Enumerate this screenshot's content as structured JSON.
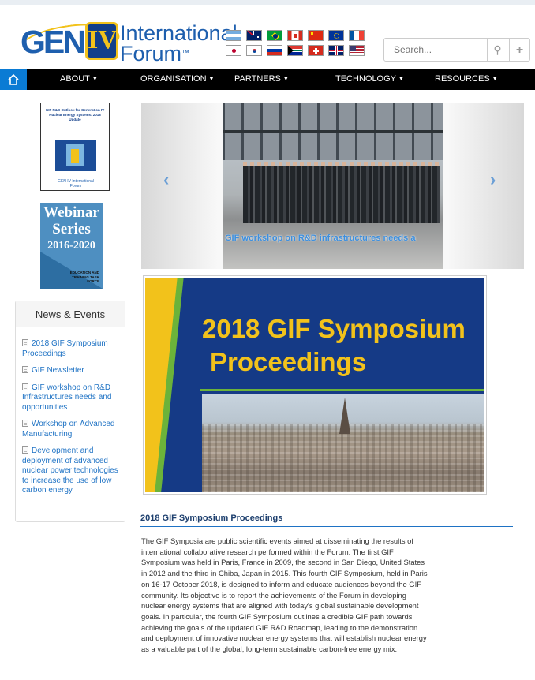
{
  "header": {
    "logo": {
      "gen": "GEN",
      "iv": "IV",
      "line1": "International",
      "line2": "Forum",
      "tm": "™"
    },
    "flags": [
      "argentina-flag",
      "australia-flag",
      "brazil-flag",
      "canada-flag",
      "china-flag",
      "euratom-flag",
      "france-flag",
      "japan-flag",
      "korea-flag",
      "russia-flag",
      "south-africa-flag",
      "switzerland-flag",
      "uk-flag",
      "usa-flag"
    ],
    "search": {
      "placeholder": "Search...",
      "search_icon": "magnifier-icon",
      "plus_icon": "plus-icon"
    }
  },
  "nav": {
    "home_icon": "home-icon",
    "items": [
      "ABOUT",
      "ORGANISATION",
      "PARTNERS",
      "TECHNOLOGY",
      "RESOURCES"
    ]
  },
  "sidebar": {
    "book": {
      "title": "GIF R&D Outlook for Generation IV Nuclear Energy Systems: 2018 Update",
      "logo": "GEN IV International Forum"
    },
    "webinar": {
      "line1": "Webinar",
      "line2": "Series",
      "years": "2016-2020",
      "tag": "EDUCATION AND TRAINING TASK FORCE"
    },
    "news": {
      "heading": "News & Events",
      "items": [
        "2018 GIF Symposium Proceedings",
        "GIF Newsletter",
        "GIF workshop on R&D Infrastructures needs and opportunities",
        "Workshop on Advanced Manufacturing",
        "Development and deployment of advanced nuclear power technologies to increase the use of low carbon energy"
      ]
    }
  },
  "carousel": {
    "caption": "GIF workshop on R&D infrastructures needs a",
    "prev": "‹",
    "next": "›"
  },
  "banner": {
    "line1": "2018 GIF Symposium",
    "line2": "Proceedings"
  },
  "article": {
    "title": "2018 GIF Symposium Proceedings",
    "body": "The GIF Symposia are public scientific events aimed at disseminating the results of international collaborative research performed within the Forum. The first GIF Symposium was held in Paris, France in 2009, the second in San Diego, United States in 2012 and the third in Chiba, Japan in 2015. This fourth GIF Symposium, held in Paris on 16-17 October 2018, is designed to inform and educate audiences beyond the GIF community. Its objective is to report the achievements of the Forum in developing nuclear energy systems that are aligned with today's global sustainable development goals. In particular, the fourth GIF Symposium outlines a credible GIF path towards achieving the goals of the updated GIF R&D Roadmap, leading to the demonstration and deployment of innovative nuclear energy systems that will establish nuclear energy as a valuable part of the global, long-term sustainable carbon-free energy mix."
  },
  "colors": {
    "brand_blue": "#1e5fae",
    "gold": "#f2c21b",
    "nav_bg": "#000000",
    "home_bg": "#0a7bd4",
    "link": "#1e72c4"
  }
}
